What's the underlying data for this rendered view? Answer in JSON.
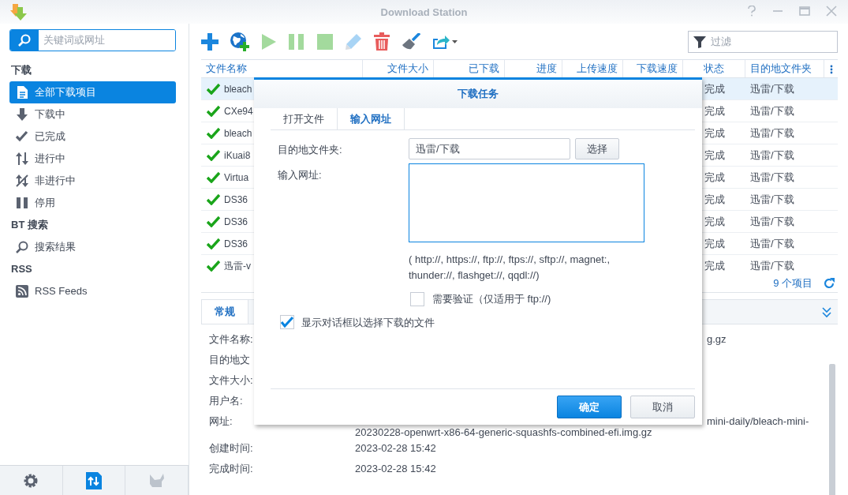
{
  "window": {
    "title": "Download Station"
  },
  "search": {
    "placeholder": "关键词或网址"
  },
  "sidebar": {
    "sections": [
      {
        "heading": "下载",
        "items": [
          {
            "label": "全部下载项目",
            "selected": true
          },
          {
            "label": "下载中",
            "selected": false
          },
          {
            "label": "已完成",
            "selected": false
          },
          {
            "label": "进行中",
            "selected": false
          },
          {
            "label": "非进行中",
            "selected": false
          },
          {
            "label": "停用",
            "selected": false
          }
        ]
      },
      {
        "heading": "BT 搜索",
        "items": [
          {
            "label": "搜索结果",
            "selected": false
          }
        ]
      },
      {
        "heading": "RSS",
        "items": [
          {
            "label": "RSS Feeds",
            "selected": false
          }
        ]
      }
    ]
  },
  "filter": {
    "placeholder": "过滤"
  },
  "table": {
    "columns": [
      "文件名称",
      "文件大小",
      "已下载",
      "进度",
      "上传速度",
      "下载速度",
      "状态",
      "目的地文件夹"
    ],
    "rows": [
      {
        "name": "bleach",
        "status": "完成",
        "destination": "迅雷/下载",
        "selected": true
      },
      {
        "name": "CXe94",
        "status": "完成",
        "destination": "迅雷/下载",
        "selected": false
      },
      {
        "name": "bleach",
        "status": "完成",
        "destination": "迅雷/下载",
        "selected": false
      },
      {
        "name": "iKuai8",
        "status": "完成",
        "destination": "迅雷/下载",
        "selected": false
      },
      {
        "name": "Virtua",
        "status": "完成",
        "destination": "迅雷/下载",
        "selected": false
      },
      {
        "name": "DS36",
        "status": "完成",
        "destination": "迅雷/下载",
        "selected": false
      },
      {
        "name": "DS36",
        "status": "完成",
        "destination": "迅雷/下载",
        "selected": false
      },
      {
        "name": "DS36",
        "status": "完成",
        "destination": "迅雷/下载",
        "selected": false
      },
      {
        "name": "迅雷-v",
        "status": "完成",
        "destination": "迅雷/下载",
        "selected": false
      }
    ],
    "count": "9 个项目"
  },
  "details": {
    "tabs": [
      {
        "label": "常规",
        "selected": true
      }
    ],
    "fields": [
      {
        "label": "文件名称:",
        "value": [
          "g.gz"
        ]
      },
      {
        "label": "目的地文"
      },
      {
        "label": "文件大小:"
      },
      {
        "label": "用户名:"
      },
      {
        "label": "网址:",
        "value": [
          "mini-daily/bleach-mini-",
          "20230228-openwrt-x86-64-generic-squashfs-combined-efi.img.gz"
        ]
      },
      {
        "label": "创建时间:",
        "value": [
          "2023-02-28 15:42"
        ]
      },
      {
        "label": "完成时间:",
        "value": [
          "2023-02-28 15:42"
        ]
      }
    ]
  },
  "dialog": {
    "title": "下载任务",
    "tabs": [
      {
        "label": "打开文件",
        "selected": false
      },
      {
        "label": "输入网址",
        "selected": true
      }
    ],
    "destination_label": "目的地文件夹:",
    "destination_value": "迅雷/下载",
    "choose_button": "选择",
    "url_label": "输入网址:",
    "hint": [
      "( http://, https://, ftp://, ftps://, sftp://, magnet:,",
      "thunder://, flashget://, qqdl://)"
    ],
    "auth": {
      "label": "需要验证（仅适用于 ftp://)",
      "checked": false
    },
    "show_dialog": {
      "label": "显示对话框以选择下载的文件",
      "checked": true
    },
    "buttons": [
      {
        "label": "确定",
        "kind": "primary"
      },
      {
        "label": "取消",
        "kind": "secondary"
      }
    ]
  }
}
